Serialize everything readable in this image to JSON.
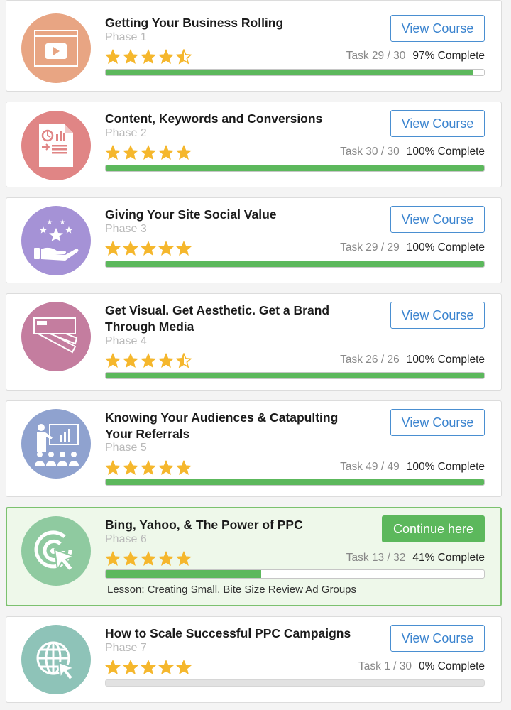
{
  "colors": {
    "star": "#f5b72d",
    "progress": "#5cb85c",
    "button_blue": "#3b84cf",
    "button_green": "#5cb85c"
  },
  "courses": [
    {
      "title": "Getting Your Business Rolling",
      "phase": "Phase 1",
      "rating": 4.5,
      "task": "Task 29 / 30",
      "percent": "97% Complete",
      "progress": 0.97,
      "button": "View Course",
      "icon": "video-player-icon",
      "icon_bg": "#e8a583"
    },
    {
      "title": "Content, Keywords and Conversions",
      "phase": "Phase 2",
      "rating": 5,
      "task": "Task 30 / 30",
      "percent": "100% Complete",
      "progress": 1.0,
      "button": "View Course",
      "icon": "report-document-icon",
      "icon_bg": "#e08585"
    },
    {
      "title": "Giving Your Site Social Value",
      "phase": "Phase 3",
      "rating": 5,
      "task": "Task 29 / 29",
      "percent": "100% Complete",
      "progress": 1.0,
      "button": "View Course",
      "icon": "hand-stars-icon",
      "icon_bg": "#a592d6"
    },
    {
      "title": "Get Visual. Get Aesthetic. Get a Brand Through Media",
      "phase": "Phase 4",
      "rating": 4.5,
      "task": "Task 26 / 26",
      "percent": "100% Complete",
      "progress": 1.0,
      "button": "View Course",
      "icon": "color-swatch-icon",
      "icon_bg": "#c47d9f"
    },
    {
      "title": "Knowing Your Audiences & Catapulting Your Referrals",
      "phase": "Phase 5",
      "rating": 5,
      "task": "Task 49 / 49",
      "percent": "100% Complete",
      "progress": 1.0,
      "button": "View Course",
      "icon": "presentation-audience-icon",
      "icon_bg": "#8fa2cf"
    },
    {
      "title": "Bing, Yahoo, & The Power of PPC",
      "phase": "Phase 6",
      "rating": 5,
      "task": "Task 13 / 32",
      "percent": "41% Complete",
      "progress": 0.41,
      "button": "Continue here",
      "lesson": "Lesson: Creating Small, Bite Size Review Ad Groups",
      "icon": "target-click-icon",
      "icon_bg": "#8fcaa0",
      "active": true
    },
    {
      "title": "How to Scale Successful PPC Campaigns",
      "phase": "Phase 7",
      "rating": 5,
      "task": "Task 1 / 30",
      "percent": "0% Complete",
      "progress": 0,
      "button": "View Course",
      "icon": "globe-cursor-icon",
      "icon_bg": "#8ec3b8"
    }
  ]
}
